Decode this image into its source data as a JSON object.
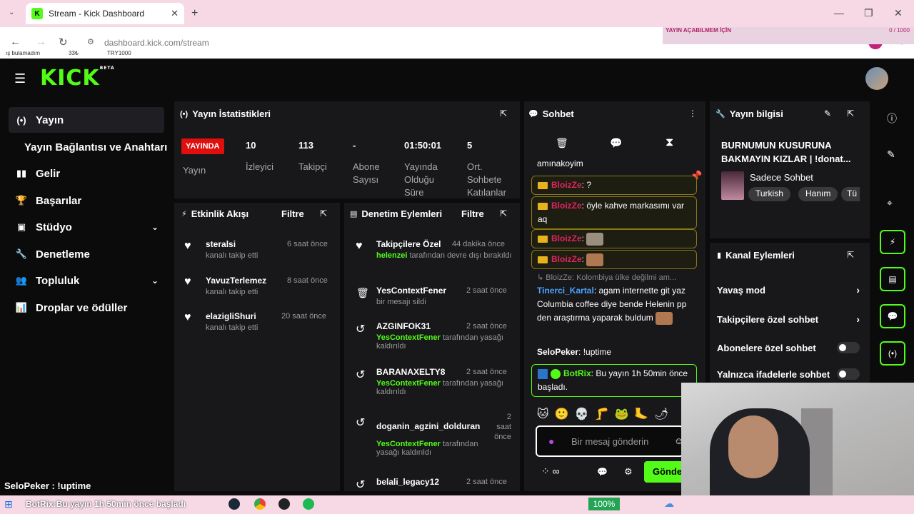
{
  "browser": {
    "tab_title": "Stream - Kick Dashboard",
    "url": "dashboard.kick.com/stream",
    "overlay_left": [
      "ış bulamadım",
      "33₺",
      "TRY1000"
    ],
    "overlay_title": "YAYIN AÇABILMEM İÇİN",
    "overlay_count": "0 / 1000"
  },
  "header": {
    "logo": "KICK",
    "beta": "BETA"
  },
  "sidebar": {
    "items": [
      {
        "label": "Yayın",
        "icon": "(•)"
      },
      {
        "label": "Yayın Bağlantısı ve Anahtarı",
        "icon": ""
      },
      {
        "label": "Gelir",
        "icon": "▮▮"
      },
      {
        "label": "Başarılar",
        "icon": "🏆"
      },
      {
        "label": "Stüdyo",
        "icon": "▣"
      },
      {
        "label": "Denetleme",
        "icon": "🔧"
      },
      {
        "label": "Topluluk",
        "icon": "👥"
      },
      {
        "label": "Droplar ve ödüller",
        "icon": "📊"
      }
    ]
  },
  "stats": {
    "title": "Yayın İstatistikleri",
    "live": "YAYINDA",
    "live_label": "Yayın",
    "items": [
      {
        "value": "10",
        "label": "İzleyici"
      },
      {
        "value": "113",
        "label": "Takipçi"
      },
      {
        "value": "-",
        "label": "Abone Sayısı"
      },
      {
        "value": "01:50:01",
        "label": "Yayında Olduğu Süre"
      },
      {
        "value": "5",
        "label": "Ort. Sohbete Katılanlar"
      }
    ]
  },
  "activity": {
    "title": "Etkinlik Akışı",
    "filter": "Filtre",
    "items": [
      {
        "name": "steralsi",
        "sub": "kanalı takip etti",
        "time": "6 saat önce"
      },
      {
        "name": "YavuzTerlemez",
        "sub": "kanalı takip etti",
        "time": "8 saat önce"
      },
      {
        "name": "elazigliShuri",
        "sub": "kanalı takip etti",
        "time": "20 saat önce"
      }
    ]
  },
  "moderation": {
    "title": "Denetim Eylemleri",
    "filter": "Filtre",
    "items": [
      {
        "name": "Takipçilere Özel",
        "time": "44 dakika önce",
        "actor": "helenzei",
        "sub": "tarafından devre dışı bırakıldı"
      },
      {
        "name": "YesContextFener",
        "time": "2 saat önce",
        "actor": "",
        "sub": "bir mesajı sildi"
      },
      {
        "name": "AZGINFOK31",
        "time": "2 saat önce",
        "actor": "YesContextFener",
        "sub": "tarafından yasağı kaldırıldı"
      },
      {
        "name": "BARANAXELTY8",
        "time": "2 saat önce",
        "actor": "YesContextFener",
        "sub": "tarafından yasağı kaldırıldı"
      },
      {
        "name": "doganin_agzini_dolduran",
        "time": "2 saat önce",
        "actor": "YesContextFener",
        "sub": "tarafından yasağı kaldırıldı"
      },
      {
        "name": "belali_legacy12",
        "time": "2 saat önce",
        "actor": "",
        "sub": ""
      }
    ]
  },
  "chat": {
    "title": "Sohbet",
    "messages": {
      "m0": "amınakoyim",
      "m1_user": "BloizZe",
      "m1_text": ": ?",
      "m2_user": "BloizZe",
      "m2_text": ": öyle kahve markasımı var aq",
      "m3_user": "BloizZe",
      "m3_text": ":",
      "m4_user": "BloizZe",
      "m4_text": ":",
      "m5_reply": "↳ BloizZe: Kolombiya ülke değilmi am...",
      "m5_user": "Tinerci_Kartal",
      "m5_text": ": agam internette git yaz Columbia coffee diye bende Helenin pp den araştırma yaparak buldum",
      "m6_user": "SeloPeker",
      "m6_text": ": !uptime",
      "m7_user": "BotRix",
      "m7_text": ": Bu yayın 1h 50min önce başladı."
    },
    "input_placeholder": "Bir mesaj gönderin",
    "send": "Gönder"
  },
  "info": {
    "title": "Yayın bilgisi",
    "stream_title": "BURNUMUN KUSURUNA BAKMAYIN KIZLAR | !donat...",
    "category": "Sadece Sohbet",
    "tags": [
      "Turkish",
      "Hanım",
      "Tü"
    ]
  },
  "actions": {
    "title": "Kanal Eylemleri",
    "items": [
      "Yavaş mod",
      "Takipçilere özel sohbet",
      "Abonelere özel sohbet",
      "Yalnızca ifadelerle sohbet"
    ]
  },
  "overlay": {
    "selo": "SeloPeker : !uptime",
    "ticker_user": "BotRix",
    "ticker_text": ":Bu yayın 1h 50min önce başladı",
    "zoom": "100%"
  },
  "colors": {
    "accent": "#53fc18",
    "live": "#e10e0e",
    "panel": "#18181b"
  }
}
